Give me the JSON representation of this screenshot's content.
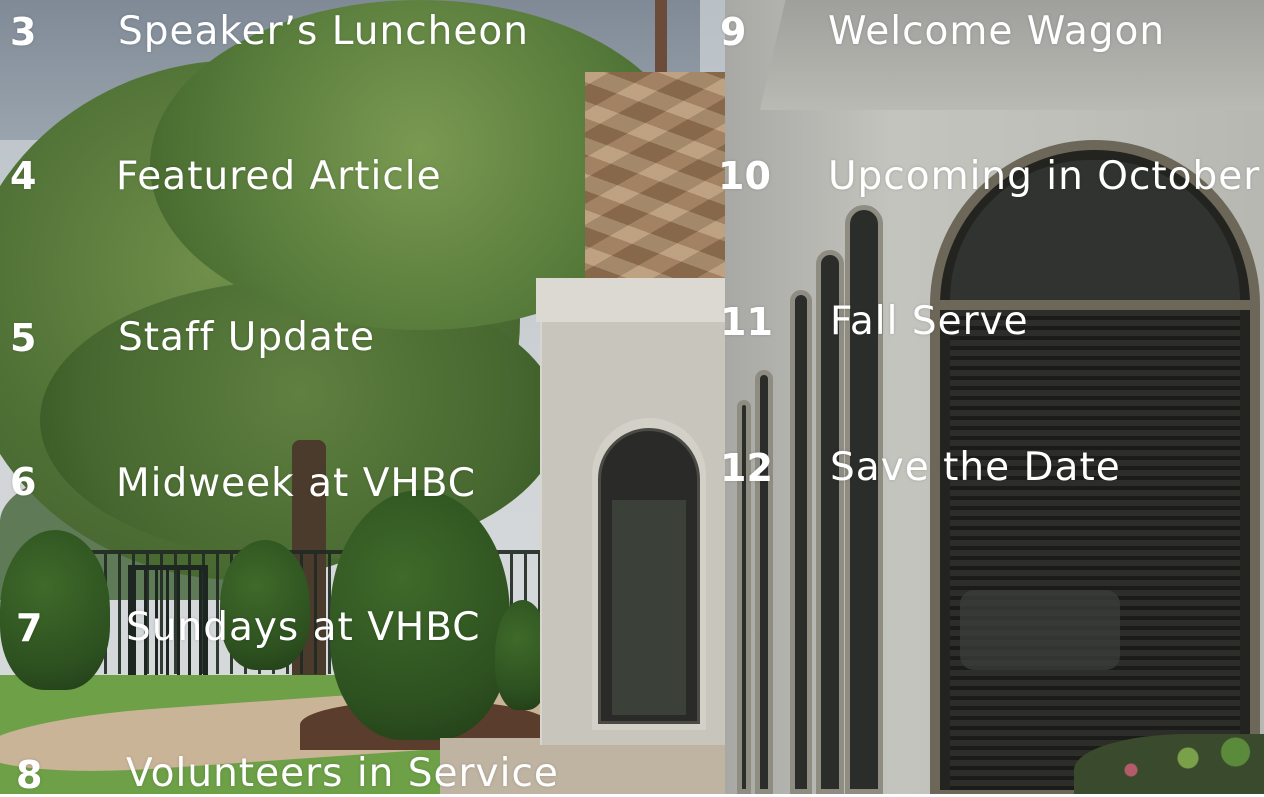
{
  "toc": {
    "left": [
      {
        "num": "3",
        "title": "Speaker’s Luncheon"
      },
      {
        "num": "4",
        "title": "Featured Article"
      },
      {
        "num": "5",
        "title": "Staff Update"
      },
      {
        "num": "6",
        "title": "Midweek at VHBC"
      },
      {
        "num": "7",
        "title": "Sundays at VHBC"
      },
      {
        "num": "8",
        "title": "Volunteers in Service"
      }
    ],
    "right": [
      {
        "num": "9",
        "title": "Welcome Wagon"
      },
      {
        "num": "10",
        "title": "Upcoming in October"
      },
      {
        "num": "11",
        "title": "Fall Serve"
      },
      {
        "num": "12",
        "title": "Save the Date"
      }
    ]
  }
}
